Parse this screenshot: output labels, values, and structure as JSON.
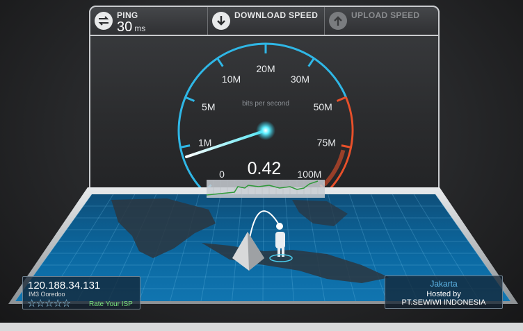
{
  "toolbar": {
    "ping": {
      "label": "PING",
      "value": "30",
      "unit": "ms",
      "icon": "ping-arrows-icon"
    },
    "download": {
      "label": "DOWNLOAD SPEED",
      "icon": "download-arrow-icon"
    },
    "upload": {
      "label": "UPLOAD SPEED",
      "icon": "upload-arrow-icon"
    }
  },
  "gauge": {
    "ticks": [
      "0",
      "1M",
      "5M",
      "10M",
      "20M",
      "30M",
      "50M",
      "75M",
      "100M"
    ],
    "unit_caption": "bits per second",
    "readout": "0.42",
    "needle_value_mbps": 0.42,
    "colors": {
      "arc": "#2fb7e6",
      "danger": "#e8502a",
      "needle_glow": "#39e0f0"
    }
  },
  "client": {
    "ip": "120.188.34.131",
    "isp": "IM3 Ooredoo",
    "rating_stars": 0,
    "rating_max": 5,
    "rate_label": "Rate Your ISP"
  },
  "server": {
    "city": "Jakarta",
    "hosted_by": "Hosted by",
    "org": "PT.SEWIWI INDONESIA"
  }
}
